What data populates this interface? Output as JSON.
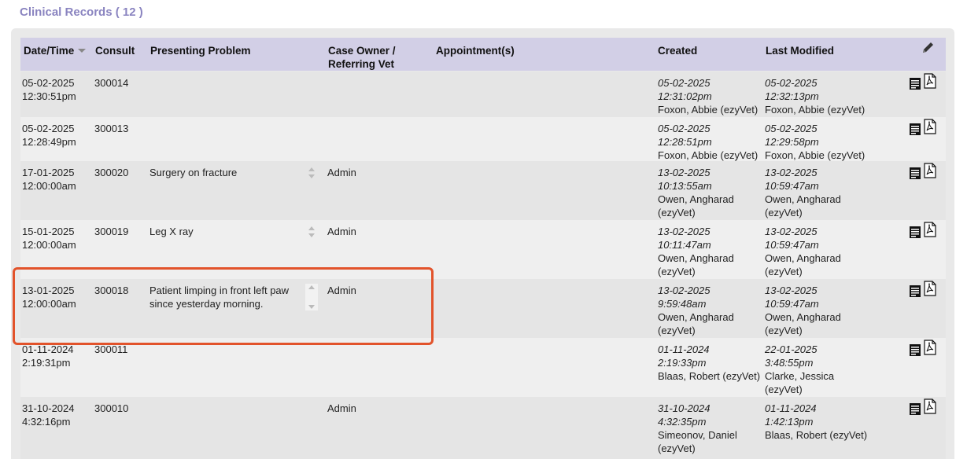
{
  "title": "Clinical Records ( 12 )",
  "columns": {
    "datetime": "Date/Time",
    "consult": "Consult",
    "problem": "Presenting Problem",
    "owner_line1": "Case Owner /",
    "owner_line2": "Referring Vet",
    "appointments": "Appointment(s)",
    "created": "Created",
    "modified": "Last Modified"
  },
  "rows": [
    {
      "date": "05-02-2025",
      "time": "12:30:51pm",
      "consult": "300014",
      "problem": "",
      "owner": "",
      "created_date": "05-02-2025",
      "created_time": "12:31:02pm",
      "created_by1": "Foxon, Abbie (ezyVet)",
      "created_by2": "",
      "modified_date": "05-02-2025",
      "modified_time": "12:32:13pm",
      "modified_by1": "Foxon, Abbie (ezyVet)",
      "modified_by2": ""
    },
    {
      "date": "05-02-2025",
      "time": "12:28:49pm",
      "consult": "300013",
      "problem": "",
      "owner": "",
      "created_date": "05-02-2025",
      "created_time": "12:28:51pm",
      "created_by1": "Foxon, Abbie (ezyVet)",
      "created_by2": "",
      "modified_date": "05-02-2025",
      "modified_time": "12:29:58pm",
      "modified_by1": "Foxon, Abbie (ezyVet)",
      "modified_by2": ""
    },
    {
      "date": "17-01-2025",
      "time": "12:00:00am",
      "consult": "300020",
      "problem": "Surgery on fracture",
      "owner": "Admin",
      "created_date": "13-02-2025",
      "created_time": "10:13:55am",
      "created_by1": "Owen, Angharad",
      "created_by2": "(ezyVet)",
      "modified_date": "13-02-2025",
      "modified_time": "10:59:47am",
      "modified_by1": "Owen, Angharad",
      "modified_by2": "(ezyVet)"
    },
    {
      "date": "15-01-2025",
      "time": "12:00:00am",
      "consult": "300019",
      "problem": "Leg X ray",
      "owner": "Admin",
      "created_date": "13-02-2025",
      "created_time": "10:11:47am",
      "created_by1": "Owen, Angharad",
      "created_by2": "(ezyVet)",
      "modified_date": "13-02-2025",
      "modified_time": "10:59:47am",
      "modified_by1": "Owen, Angharad",
      "modified_by2": "(ezyVet)"
    },
    {
      "date": "13-01-2025",
      "time": "12:00:00am",
      "consult": "300018",
      "problem": "Patient limping in front left paw since yesterday morning.",
      "owner": "Admin",
      "created_date": "13-02-2025",
      "created_time": "9:59:48am",
      "created_by1": "Owen, Angharad",
      "created_by2": "(ezyVet)",
      "modified_date": "13-02-2025",
      "modified_time": "10:59:47am",
      "modified_by1": "Owen, Angharad",
      "modified_by2": "(ezyVet)"
    },
    {
      "date": "01-11-2024",
      "time": "2:19:31pm",
      "consult": "300011",
      "problem": "",
      "owner": "",
      "created_date": "01-11-2024",
      "created_time": "2:19:33pm",
      "created_by1": "Blaas, Robert (ezyVet)",
      "created_by2": "",
      "modified_date": "22-01-2025",
      "modified_time": "3:48:55pm",
      "modified_by1": "Clarke, Jessica",
      "modified_by2": "(ezyVet)"
    },
    {
      "date": "31-10-2024",
      "time": "4:32:16pm",
      "consult": "300010",
      "problem": "",
      "owner": "Admin",
      "created_date": "31-10-2024",
      "created_time": "4:32:35pm",
      "created_by1": "Simeonov, Daniel",
      "created_by2": "(ezyVet)",
      "modified_date": "01-11-2024",
      "modified_time": "1:42:13pm",
      "modified_by1": "Blaas, Robert (ezyVet)",
      "modified_by2": ""
    }
  ]
}
